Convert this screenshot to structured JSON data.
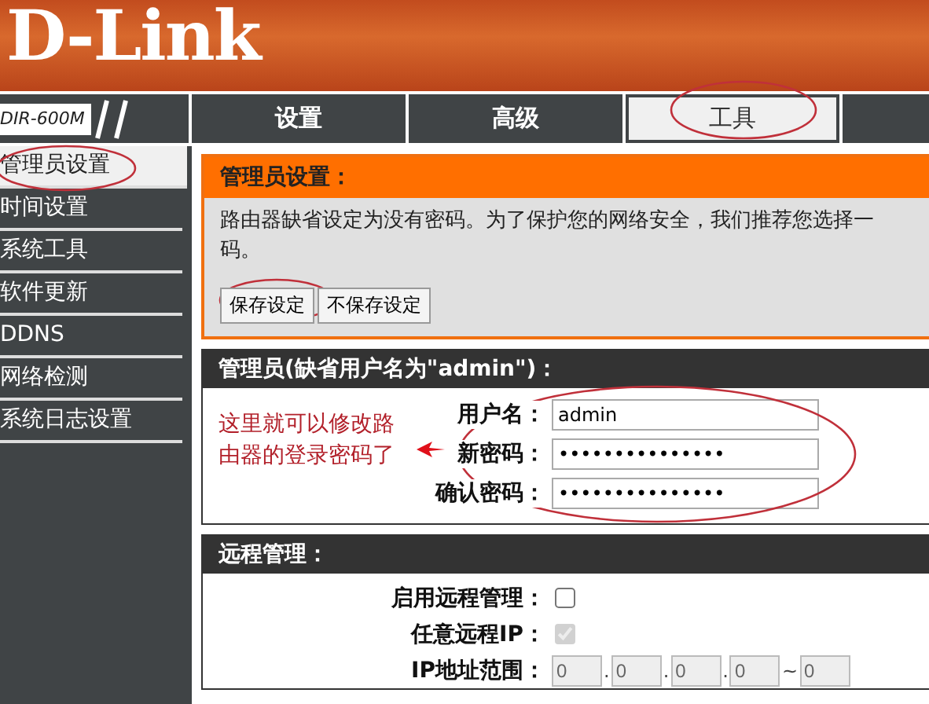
{
  "logo": {
    "text": "D-Link"
  },
  "nav": {
    "model": "DIR-600M",
    "tabs": [
      {
        "label": "设置",
        "selected": false
      },
      {
        "label": "高级",
        "selected": false
      },
      {
        "label": "工具",
        "selected": true
      }
    ]
  },
  "sidebar": {
    "items": [
      {
        "label": "管理员设置",
        "selected": true
      },
      {
        "label": "时间设置",
        "selected": false
      },
      {
        "label": "系统工具",
        "selected": false
      },
      {
        "label": "软件更新",
        "selected": false
      },
      {
        "label": "DDNS",
        "selected": false
      },
      {
        "label": "网络检测",
        "selected": false
      },
      {
        "label": "系统日志设置",
        "selected": false
      }
    ]
  },
  "admin_section": {
    "title": "管理员设置：",
    "description_lines": [
      "路由器缺省设定为没有密码。为了保护您的网络安全，我们推荐您选择一",
      "码。"
    ],
    "buttons": [
      {
        "label": "保存设定"
      },
      {
        "label": "不保存设定"
      }
    ]
  },
  "account_section": {
    "title": "管理员(缺省用户名为\"admin\")：",
    "fields": [
      {
        "label": "用户名：",
        "value": "admin"
      },
      {
        "label": "新密码：",
        "value": "•••••••••••••••"
      },
      {
        "label": "确认密码：",
        "value": "•••••••••••••••"
      }
    ]
  },
  "remote_section": {
    "title": "远程管理：",
    "rows": [
      {
        "kind": "checkbox",
        "label": "启用远程管理：",
        "checked": false,
        "disabled": false
      },
      {
        "kind": "checkbox",
        "label": "任意远程IP：",
        "checked": true,
        "disabled": true
      },
      {
        "kind": "ip_range",
        "label": "IP地址范围：",
        "octets": [
          "0",
          "0",
          "0",
          "0"
        ],
        "octet_separator": ".",
        "range_separator": "~",
        "end": "0"
      }
    ]
  },
  "annotation": {
    "text": "这里就可以修改路由器的登录密码了"
  }
}
